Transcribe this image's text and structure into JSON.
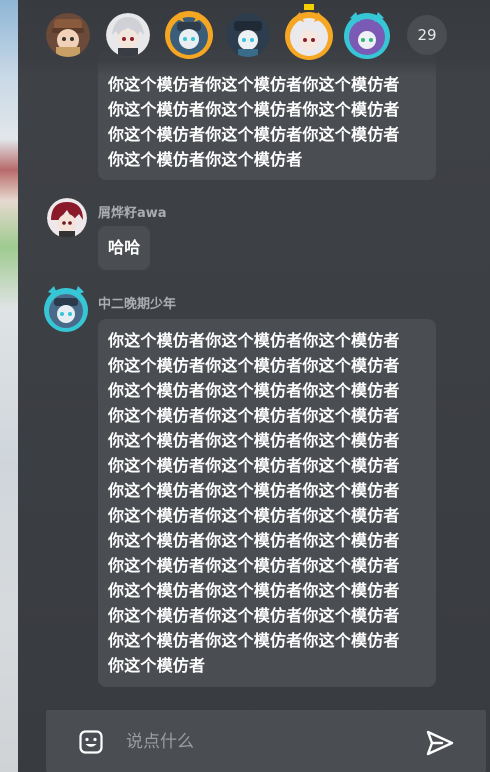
{
  "online_count": "29",
  "avatars": [
    {
      "name": "avatar-1"
    },
    {
      "name": "avatar-2"
    },
    {
      "name": "avatar-3"
    },
    {
      "name": "avatar-4"
    },
    {
      "name": "avatar-5"
    },
    {
      "name": "avatar-6"
    }
  ],
  "messages": [
    {
      "author": "",
      "lines": [
        "你这个模仿者你这个模仿者你这个模仿者",
        "你这个模仿者你这个模仿者你这个模仿者",
        "你这个模仿者你这个模仿者你这个模仿者",
        "你这个模仿者你这个模仿者"
      ]
    },
    {
      "author": "屑烨籽awa",
      "lines": [
        "哈哈"
      ]
    },
    {
      "author": "中二晚期少年",
      "lines": [
        "你这个模仿者你这个模仿者你这个模仿者",
        "你这个模仿者你这个模仿者你这个模仿者",
        "你这个模仿者你这个模仿者你这个模仿者",
        "你这个模仿者你这个模仿者你这个模仿者",
        "你这个模仿者你这个模仿者你这个模仿者",
        "你这个模仿者你这个模仿者你这个模仿者",
        "你这个模仿者你这个模仿者你这个模仿者",
        "你这个模仿者你这个模仿者你这个模仿者",
        "你这个模仿者你这个模仿者你这个模仿者",
        "你这个模仿者你这个模仿者你这个模仿者",
        "你这个模仿者你这个模仿者你这个模仿者",
        "你这个模仿者你这个模仿者你这个模仿者",
        "你这个模仿者你这个模仿者你这个模仿者",
        "你这个模仿者"
      ]
    }
  ],
  "input": {
    "placeholder": "说点什么",
    "value": ""
  },
  "icons": {
    "emoji": "emoji-icon",
    "send": "send-icon"
  },
  "colors": {
    "panel_bg": "#3b3e43",
    "bubble_bg": "#4a4d52",
    "text": "#ffffff",
    "name_text": "#a9acb0",
    "accent_orange": "#f5a623",
    "accent_teal": "#36c6d6"
  }
}
